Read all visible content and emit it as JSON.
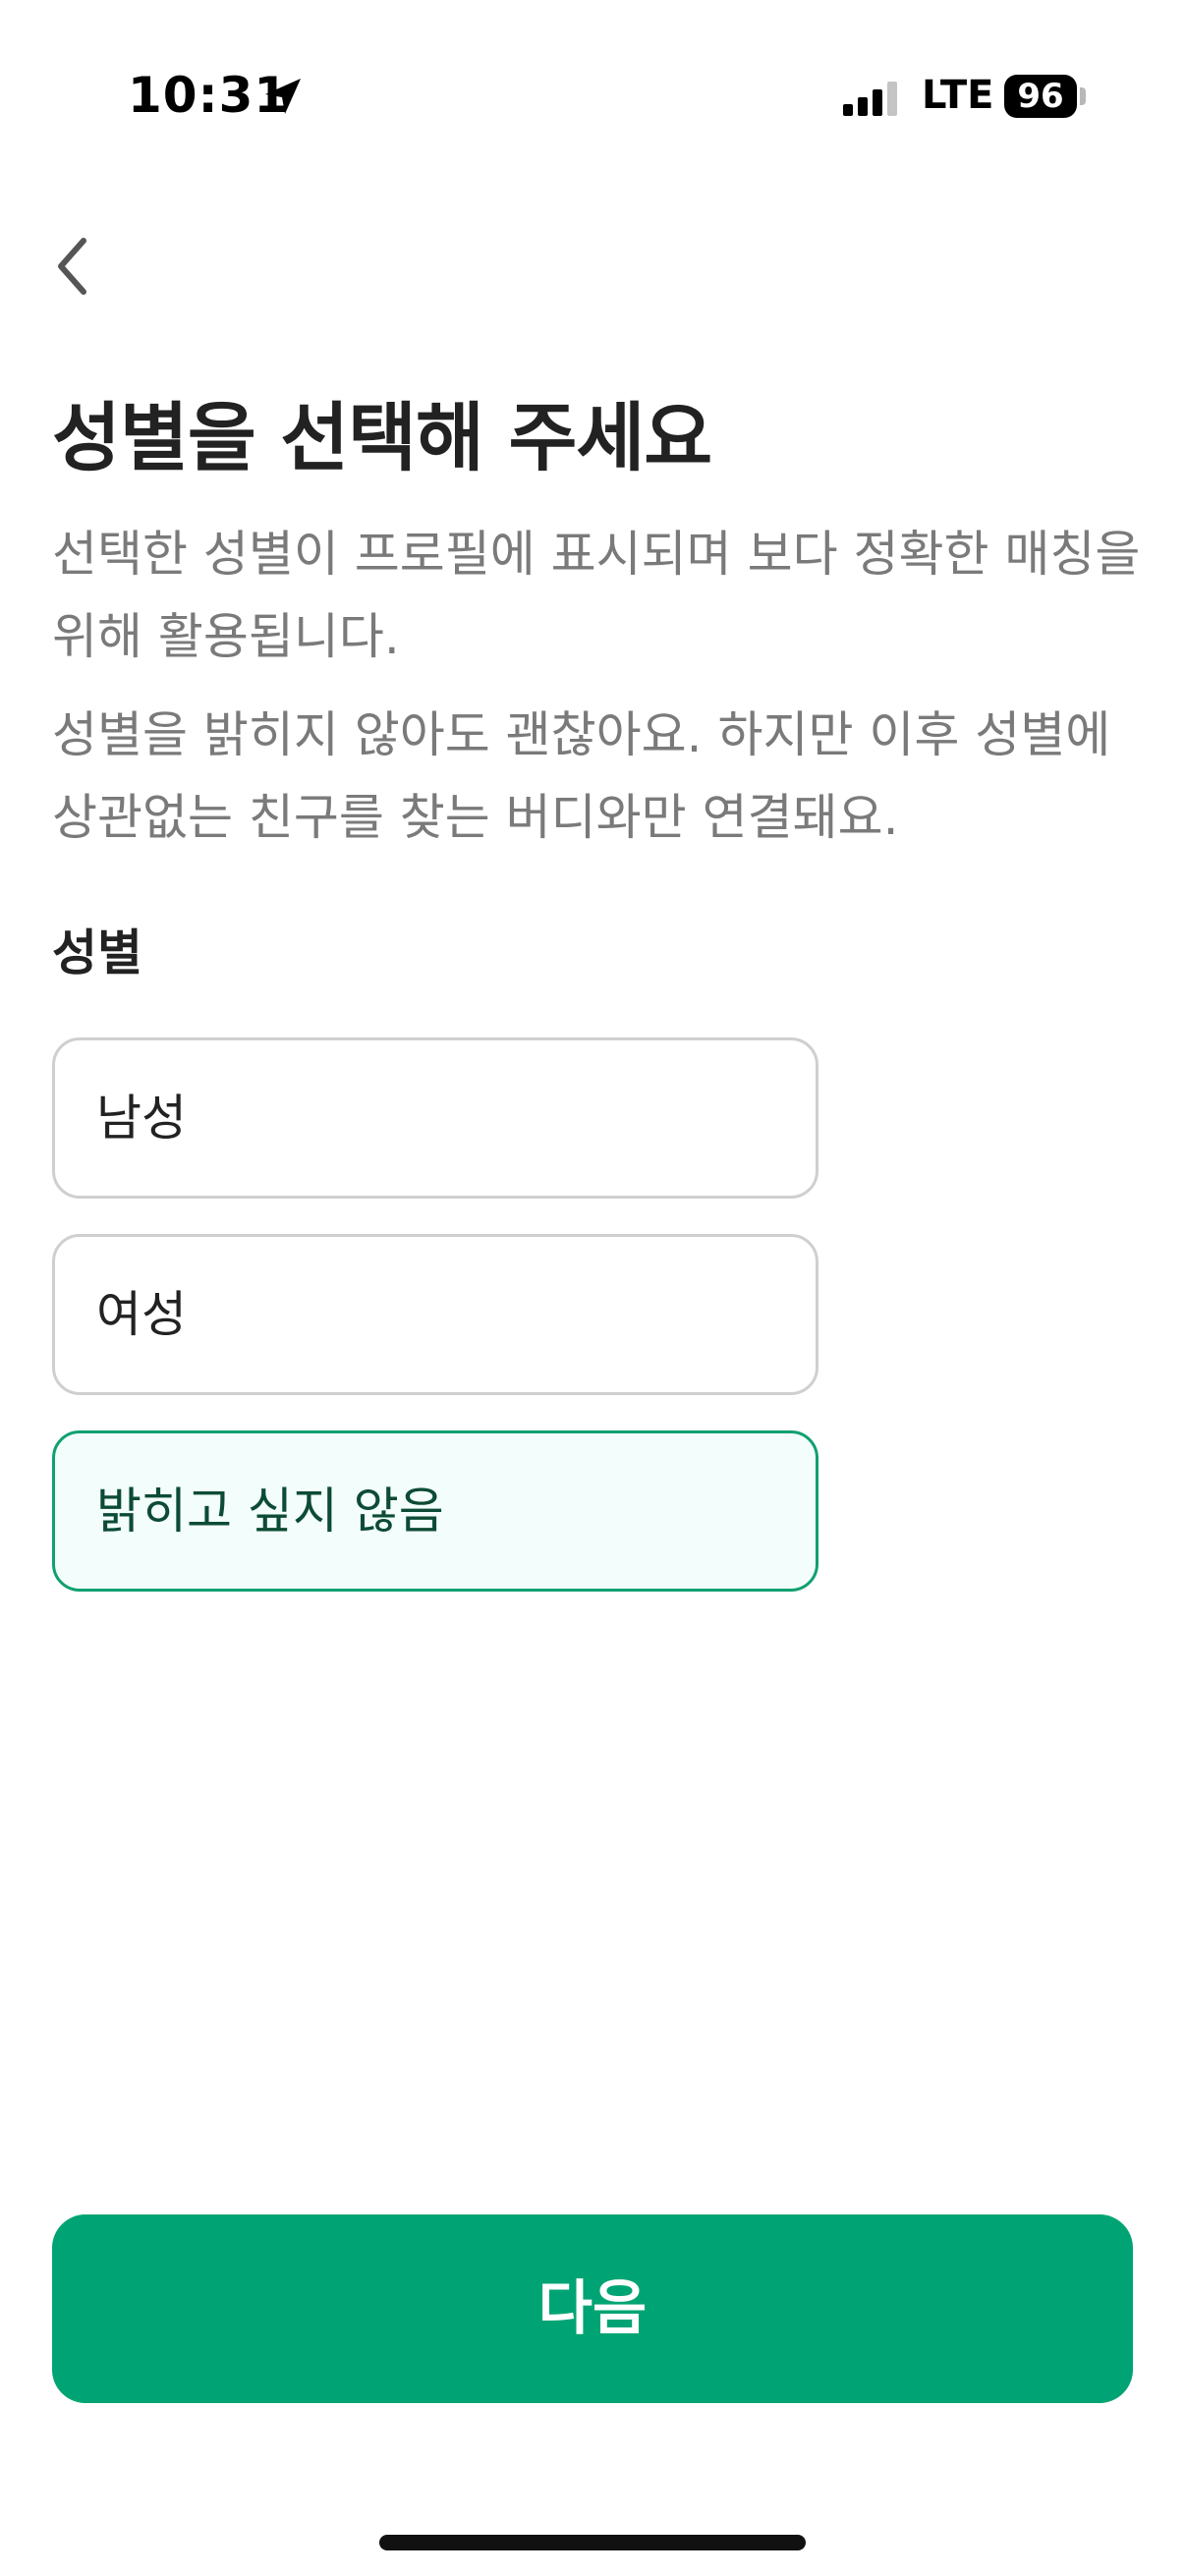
{
  "status_bar": {
    "time": "10:31",
    "network": "LTE",
    "battery": "96",
    "icons": [
      "location-arrow-icon",
      "signal-bars-icon",
      "battery-icon"
    ]
  },
  "header": {
    "back_icon": "chevron-left-icon",
    "title": "성별을 선택해 주세요",
    "description_1": "선택한 성별이 프로필에 표시되며 보다 정확한 매칭을 위해 활용됩니다.",
    "description_2": "성별을 밝히지 않아도 괜찮아요. 하지만 이후 성별에 상관없는 친구를 찾는 버디와만 연결돼요."
  },
  "gender": {
    "label": "성별",
    "options": [
      {
        "label": "남성",
        "selected": false
      },
      {
        "label": "여성",
        "selected": false
      },
      {
        "label": "밝히고 싶지 않음",
        "selected": true
      }
    ]
  },
  "footer": {
    "next_label": "다음"
  },
  "colors": {
    "accent": "#00a474",
    "selected_border": "#11a070",
    "selected_background": "#f3fdfb",
    "muted_text": "#7a7a7a"
  }
}
